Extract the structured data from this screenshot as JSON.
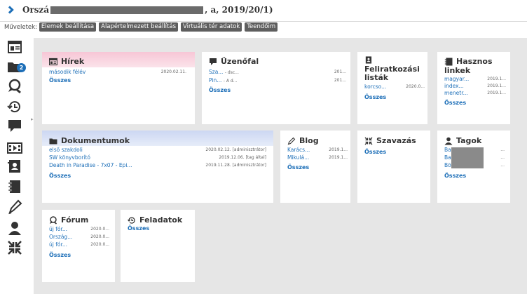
{
  "title": {
    "prefix": "Orszá",
    "suffix": ", a, 2019/20/1)"
  },
  "toolbar": {
    "label": "Műveletek:",
    "buttons": [
      "Elemek beállítása",
      "Alapértelmezett beállítás",
      "Virtuális tér adatok",
      "Teendőim"
    ]
  },
  "sidebar": {
    "badge": "2",
    "icons": [
      "dashboard-icon",
      "folder-icon",
      "search-icon",
      "history-icon",
      "chat-icon",
      "film-icon",
      "contacts-book-icon",
      "notebook-icon",
      "pen-icon",
      "user-icon",
      "collapse-icon"
    ]
  },
  "cards": {
    "hirek": {
      "title": "Hírek",
      "row": {
        "text": "második félév",
        "date": "2020.02.11."
      },
      "all": "Összes"
    },
    "uzenofal": {
      "title": "Üzenőfal",
      "rows": [
        {
          "text": "Sza...",
          "meta": "- dsc...",
          "date": "201..."
        },
        {
          "text": "Pin...",
          "meta": "- A d...",
          "date": "201..."
        }
      ],
      "all": "Összes"
    },
    "feliratkozasi": {
      "title": "Feliratkozási listák",
      "row": {
        "text": "korcso...",
        "date": "2020.0..."
      },
      "all": "Összes"
    },
    "hasznos": {
      "title": "Hasznos linkek",
      "rows": [
        {
          "text": "magyar...",
          "date": "2019.1..."
        },
        {
          "text": "index...",
          "date": "2019.1..."
        },
        {
          "text": "menetr...",
          "date": "2019.1..."
        }
      ],
      "all": "Összes"
    },
    "dokumentumok": {
      "title": "Dokumentumok",
      "rows": [
        {
          "text": "első szakdoli",
          "date": "2020.02.12. [adminisztrátor]"
        },
        {
          "text": "SW könyvborító",
          "date": "2019.12.06. [tag által]"
        },
        {
          "text": "Death in Paradise - 7x07 - Epi...",
          "date": "2019.11.28. [adminisztrátor]"
        }
      ],
      "all": "Összes"
    },
    "blog": {
      "title": "Blog",
      "rows": [
        {
          "text": "Karács...",
          "date": "2019.1..."
        },
        {
          "text": "Mikulá...",
          "date": "2019.1..."
        }
      ],
      "all": "Összes"
    },
    "szavazas": {
      "title": "Szavazás",
      "all": "Összes"
    },
    "tagok": {
      "title": "Tagok",
      "rows": [
        {
          "text": "Ba",
          "date": "..."
        },
        {
          "text": "Ba",
          "date": "..."
        },
        {
          "text": "Bö",
          "date": "..."
        }
      ],
      "all": "Összes"
    },
    "forum": {
      "title": "Fórum",
      "rows": [
        {
          "text": "új fór...",
          "date": "2020.0..."
        },
        {
          "text": "Ország...",
          "date": "2020.0..."
        },
        {
          "text": "új fór...",
          "date": "2020.0..."
        }
      ],
      "all": "Összes"
    },
    "feladatok": {
      "title": "Feladatok",
      "all": "Összes"
    }
  },
  "colors": {
    "accent": "#1d6fb8",
    "hirek_header": "#f7c6d6",
    "dok_header": "#ccd7f2",
    "panel_bg": "#e6e6e6"
  }
}
